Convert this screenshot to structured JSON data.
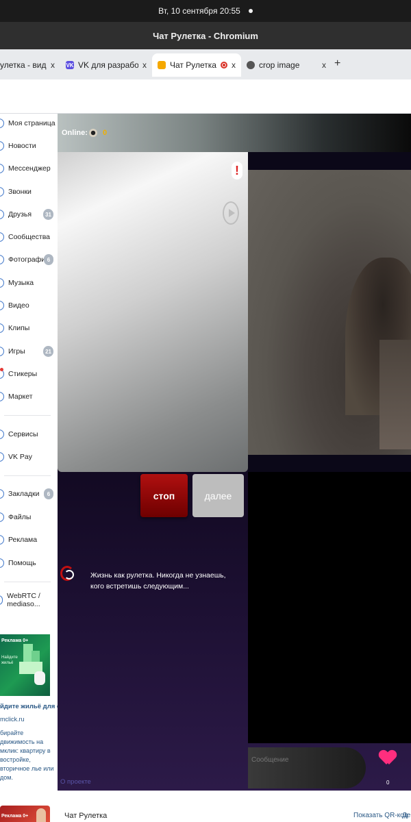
{
  "system": {
    "datetime": "Вт, 10 сентября  20:55"
  },
  "window": {
    "title": "Чат Рулетка - Chromium"
  },
  "tabs": [
    {
      "label": "улетка - видеочат",
      "close": "x"
    },
    {
      "label": "VK для разработчиков",
      "close": "x",
      "favicon": "VK"
    },
    {
      "label": "Чат Рулетка",
      "close": "x"
    },
    {
      "label": "crop image",
      "close": "x"
    }
  ],
  "new_tab": "+",
  "sidebar": {
    "items": [
      {
        "label": "Моя страница"
      },
      {
        "label": "Новости"
      },
      {
        "label": "Мессенджер"
      },
      {
        "label": "Звонки"
      },
      {
        "label": "Друзья",
        "badge": "31"
      },
      {
        "label": "Сообщества"
      },
      {
        "label": "Фотографии",
        "badge": "6"
      },
      {
        "label": "Музыка"
      },
      {
        "label": "Видео"
      },
      {
        "label": "Клипы"
      },
      {
        "label": "Игры",
        "badge": "21"
      },
      {
        "label": "Стикеры"
      },
      {
        "label": "Маркет"
      },
      {
        "label": "Сервисы"
      },
      {
        "label": "VK Pay"
      },
      {
        "label": "Закладки",
        "badge": "6"
      },
      {
        "label": "Файлы"
      },
      {
        "label": "Реклама"
      },
      {
        "label": "Помощь"
      },
      {
        "label": "WebRTC / mediaso..."
      }
    ],
    "ad": {
      "image_tag": "Реклама 0+",
      "image_text": "Найдите жильё",
      "title": "йдите жильё для себя",
      "domain": "mclick.ru",
      "description": "бирайте движимость на мклик: квартиру в востройке, вторичное лье или дом."
    },
    "ad2_tag": "Реклама 0+"
  },
  "chat": {
    "online_label": "Online: 1",
    "views": "0",
    "report": "!",
    "stop_label": "стоп",
    "next_label": "далее",
    "tagline": "Жизнь как рулетка. Никогда не узнаешь, кого встретишь следующим...",
    "message_placeholder": "Сообщение",
    "hearts": "0",
    "about": "О проекте"
  },
  "footer": {
    "app_title": "Чат Рулетка",
    "qr_link": "Показать QR-код",
    "actions_link": "Дей"
  },
  "colors": {
    "accent_blue": "#2a5885",
    "stop_red": "#b01010",
    "views_yellow": "#f0b000",
    "heart_pink": "#ff2e7e"
  }
}
